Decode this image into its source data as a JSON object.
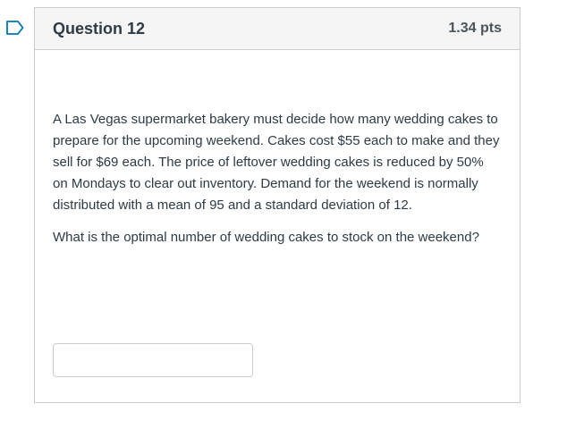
{
  "question": {
    "title": "Question 12",
    "points": "1.34 pts",
    "paragraphs": [
      "A Las Vegas supermarket bakery must decide how many wedding cakes to prepare for the upcoming weekend.  Cakes cost $55 each to make and they sell for $69 each.  The price of leftover wedding cakes is reduced by 50% on Mondays to clear out inventory.  Demand for the weekend is normally distributed with a mean of 95 and a standard deviation of 12.",
      "What is the optimal number of wedding cakes to stock on the weekend?"
    ],
    "answer": {
      "value": "",
      "placeholder": ""
    }
  },
  "icons": {
    "flag": "bookmark-flag-icon"
  },
  "colors": {
    "flag": "#0374b5",
    "border": "#c7cdd1",
    "header_bg": "#f5f5f5",
    "text": "#2d3b45"
  }
}
